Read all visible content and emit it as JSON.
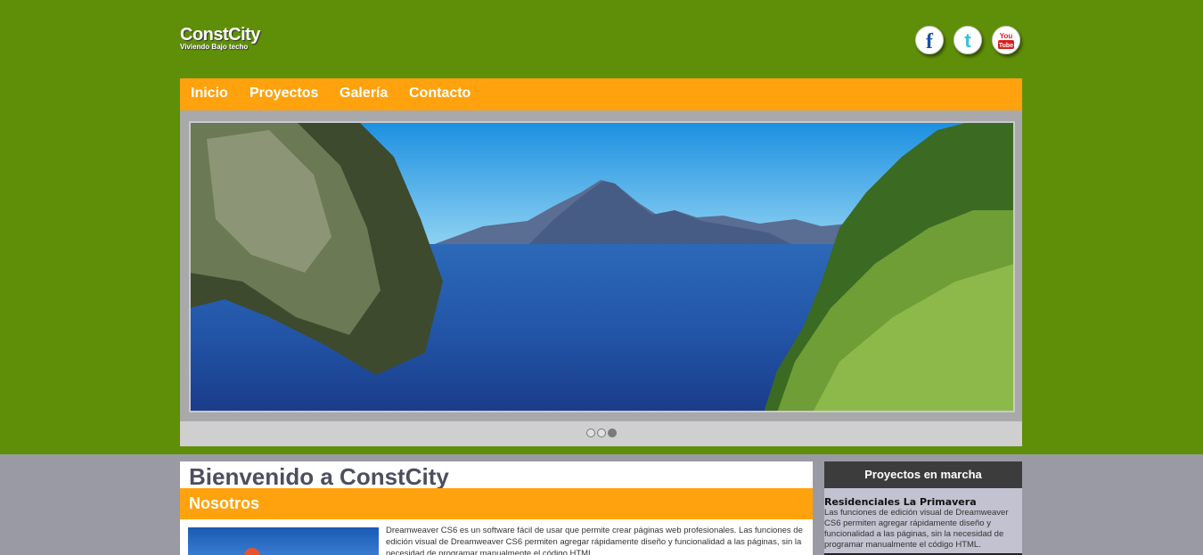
{
  "brand": {
    "name": "ConstCity",
    "tagline": "Viviendo Bajo techo"
  },
  "social": [
    {
      "icon": "facebook-icon",
      "glyph": "f",
      "color": "#1d4fa0"
    },
    {
      "icon": "twitter-icon",
      "glyph": "t",
      "color": "#2fc3e6"
    },
    {
      "icon": "youtube-icon",
      "glyph_top": "You",
      "glyph_bottom": "Tube",
      "color": "#d42020"
    }
  ],
  "nav": {
    "items": [
      "Inicio",
      "Proyectos",
      "Galería",
      "Contacto"
    ]
  },
  "slider": {
    "slide_count": 3,
    "active_index": 2
  },
  "main": {
    "title": "Bienvenido a ConstCity",
    "section_title": "Nosotros",
    "body": "Dreamweaver CS6 es un software fácil de usar que permite crear páginas web profesionales. Las funciones de edición visual de Dreamweaver CS6 permiten agregar rápidamente diseño y funcionalidad a las páginas, sin la necesidad de programar manualmente el código HTML."
  },
  "sidebar": {
    "heading": "Proyectos en marcha",
    "items": [
      {
        "title": "Residenciales La Primavera",
        "text": "Las funciones de edición visual de Dreamweaver CS6 permiten agregar rápidamente diseño y funcionalidad a las páginas, sin la necesidad de programar manualmente el código HTML."
      }
    ]
  },
  "colors": {
    "header_bg": "#5f8f08",
    "accent": "#ffa20d",
    "page_bg": "#9a9aa4",
    "title_text": "#4c4f5e",
    "sidebar_head": "#3c3c3c"
  }
}
